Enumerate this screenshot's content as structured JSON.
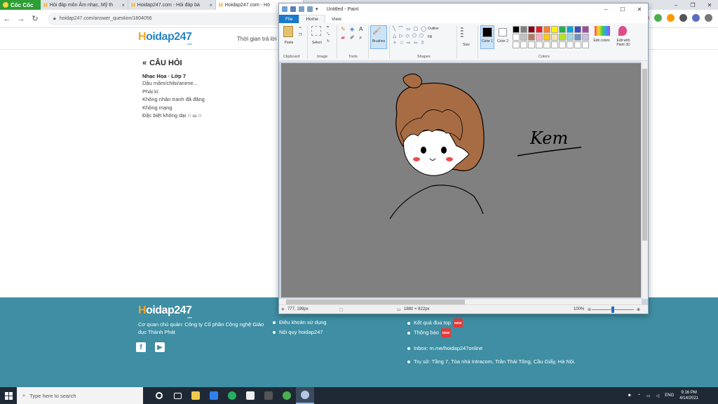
{
  "browser": {
    "logo": "Cốc Cốc",
    "tabs": [
      {
        "title": "Hỏi đáp môn Âm nhạc, Mỹ th"
      },
      {
        "title": "Hoidap247.com - Hỏi đáp bà"
      },
      {
        "title": "Hoidap247.com - Hỏ"
      }
    ],
    "url": "hoidap247.com/answer_question/1804056"
  },
  "site": {
    "logo_part1": "H",
    "logo_part2": "oidap247",
    "logo_sub": ".com",
    "header_text": "Thời gian trả lời",
    "question": {
      "title": "CÂU HỎI",
      "subject": "Nhạc Họa · Lớp 7",
      "lines": [
        "Dậu mầm/chibi/anime...",
        "Phải kí",
        "Không nhận tranh đã đăng",
        "Không mạng",
        "Đặc biệt không dại   ∩ ω ∩"
      ]
    },
    "footer": {
      "company": "Cơ quan chủ quản: Công ty Cổ phần Công nghệ Giáo dục Thành Phát",
      "links_left": [
        "Điều khoản sử dụng",
        "Nội quy hoidap247"
      ],
      "links_right": [
        "Kết quả đua top",
        "Thông báo"
      ],
      "new_badge": "NEW",
      "inbox": "Inbox: m.me/hoidap247online",
      "address": "Trụ sở: Tầng 7, Tòa nhà Intracom, Trần Thái Tông, Cầu Giấy, Hà Nội."
    }
  },
  "paint": {
    "title": "Untitled - Paint",
    "menus": [
      "File",
      "Home",
      "View"
    ],
    "groups": [
      "Clipboard",
      "Image",
      "Tools",
      "Shapes",
      "Colors"
    ],
    "buttons": {
      "paste": "Paste",
      "select": "Select",
      "brushes": "Brushes",
      "outline": "Outline",
      "fill": "Fill",
      "size": "Size",
      "color1": "Color 1",
      "color2": "Color 2",
      "edit_colors": "Edit colors",
      "edit_paint3d": "Edit with Paint 3D"
    },
    "palette_colors": [
      "#000000",
      "#7f7f7f",
      "#880015",
      "#ed1c24",
      "#ff7f27",
      "#fff200",
      "#22b14c",
      "#00a2e8",
      "#3f48cc",
      "#a349a4",
      "#ffffff",
      "#c3c3c3",
      "#b97a57",
      "#ffaec9",
      "#ffc90e",
      "#efe4b0",
      "#b5e61d",
      "#99d9ea",
      "#7092be",
      "#c8bfe7",
      "#ffffff",
      "#ffffff",
      "#ffffff",
      "#ffffff",
      "#ffffff",
      "#ffffff",
      "#ffffff",
      "#ffffff",
      "#ffffff",
      "#ffffff"
    ],
    "canvas_text": "Kem",
    "status": {
      "cursor": "777, 199px",
      "size": "1880 × 822px",
      "zoom": "100%"
    }
  },
  "taskbar": {
    "search_placeholder": "Type here to search",
    "time": "9:16 PM",
    "date": "4/14/2021",
    "lang": "ENG"
  }
}
